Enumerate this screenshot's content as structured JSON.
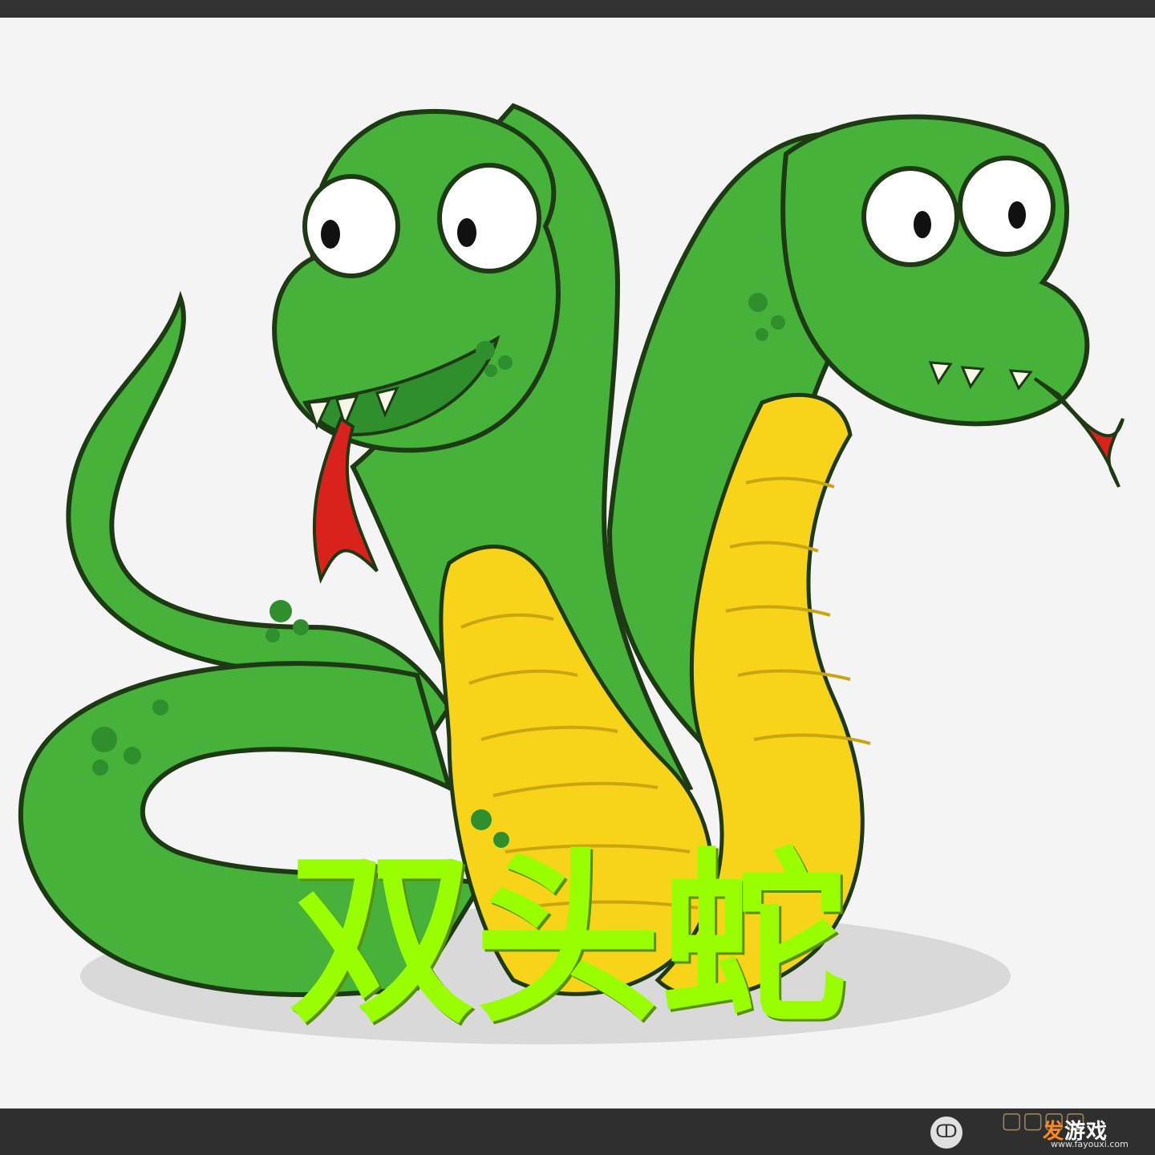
{
  "title": "双头蛇",
  "colors": {
    "title": "#99ff00",
    "snake_body": "#46b23a",
    "snake_dark": "#2f8f2c",
    "belly": "#f7d31a",
    "tongue": "#d9221b",
    "outline": "#1e3a14",
    "background": "#f4f4f4",
    "frame": "#333333",
    "watermark_accent": "#ff8a1a"
  },
  "watermark": {
    "logo_glyph": "ↀ",
    "name_accent": "发",
    "name_rest": "游戏",
    "url": "www.fayouxi.com",
    "faded_text": "▢▢▢▢"
  },
  "icons": [
    "snake-illustration",
    "watermark-logo-icon"
  ]
}
